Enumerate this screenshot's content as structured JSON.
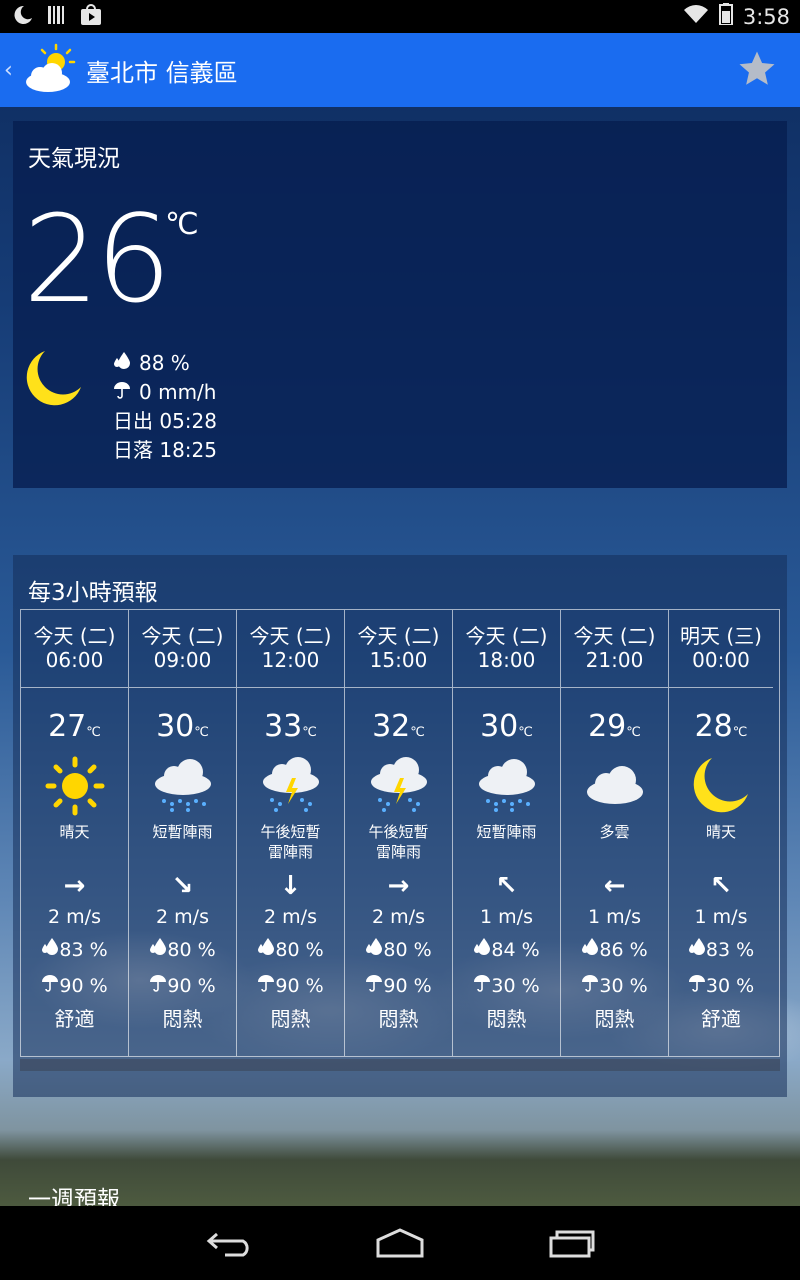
{
  "status_bar": {
    "time": "3:58"
  },
  "app_bar": {
    "title": "臺北市 信義區"
  },
  "current": {
    "section_title": "天氣現況",
    "temperature": "26",
    "unit": "℃",
    "humidity": "88 %",
    "rain": "0 mm/h",
    "sunrise": "日出 05:28",
    "sunset": "日落 18:25",
    "icon": "moon-icon"
  },
  "forecast": {
    "section_title": "每3小時預報",
    "unit": "℃",
    "items": [
      {
        "day": "今天 (二)",
        "time": "06:00",
        "temp": "27",
        "icon": "sunny-icon",
        "desc": "晴天",
        "wind_dir": "→",
        "wind": "2 m/s",
        "humidity": "83 %",
        "rain": "90 %",
        "comfort": "舒適"
      },
      {
        "day": "今天 (二)",
        "time": "09:00",
        "temp": "30",
        "icon": "rain-cloud-icon",
        "desc": "短暫陣雨",
        "wind_dir": "↘",
        "wind": "2 m/s",
        "humidity": "80 %",
        "rain": "90 %",
        "comfort": "悶熱"
      },
      {
        "day": "今天 (二)",
        "time": "12:00",
        "temp": "33",
        "icon": "thunderstorm-icon",
        "desc": "午後短暫雷陣雨",
        "wind_dir": "↓",
        "wind": "2 m/s",
        "humidity": "80 %",
        "rain": "90 %",
        "comfort": "悶熱"
      },
      {
        "day": "今天 (二)",
        "time": "15:00",
        "temp": "32",
        "icon": "thunderstorm-icon",
        "desc": "午後短暫雷陣雨",
        "wind_dir": "→",
        "wind": "2 m/s",
        "humidity": "80 %",
        "rain": "90 %",
        "comfort": "悶熱"
      },
      {
        "day": "今天 (二)",
        "time": "18:00",
        "temp": "30",
        "icon": "rain-cloud-icon",
        "desc": "短暫陣雨",
        "wind_dir": "↖",
        "wind": "1 m/s",
        "humidity": "84 %",
        "rain": "30 %",
        "comfort": "悶熱"
      },
      {
        "day": "今天 (二)",
        "time": "21:00",
        "temp": "29",
        "icon": "cloud-icon",
        "desc": "多雲",
        "wind_dir": "←",
        "wind": "1 m/s",
        "humidity": "86 %",
        "rain": "30 %",
        "comfort": "悶熱"
      },
      {
        "day": "明天 (三)",
        "time": "00:00",
        "temp": "28",
        "icon": "moon-icon",
        "desc": "晴天",
        "wind_dir": "↖",
        "wind": "1 m/s",
        "humidity": "83 %",
        "rain": "30 %",
        "comfort": "舒適"
      }
    ]
  },
  "week": {
    "section_title": "一週預報"
  },
  "colors": {
    "app_bar": "#1a6cf0",
    "sun": "#ffd600",
    "moon": "#ffe11a"
  }
}
